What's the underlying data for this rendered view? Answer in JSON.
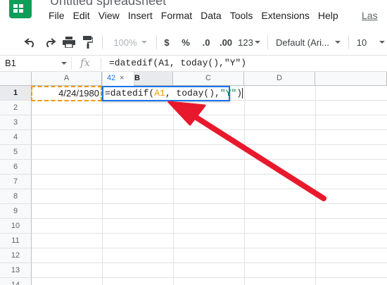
{
  "app": {
    "title": "Untitled spreadsheet",
    "logo": "sheets-logo-icon"
  },
  "menu": {
    "items": [
      "File",
      "Edit",
      "View",
      "Insert",
      "Format",
      "Data",
      "Tools",
      "Extensions",
      "Help"
    ],
    "extra": "Las"
  },
  "toolbar": {
    "undo": "undo-icon",
    "redo": "redo-icon",
    "print": "print-icon",
    "paint_format": "paint-format-icon",
    "zoom": "100%",
    "currency": "$",
    "percent": "%",
    "decrease_decimal": ".0",
    "increase_decimal": ".00",
    "more_formats": "123",
    "font": "Default (Ari...",
    "font_size": "10"
  },
  "formula_bar": {
    "name_box": "B1",
    "fx_icon": "fx-icon",
    "formula": "=datedif(A1, today(),\"Y\")"
  },
  "grid": {
    "columns": [
      "A",
      "B",
      "C",
      "D"
    ],
    "rows": [
      "1",
      "2",
      "3",
      "4",
      "5",
      "6",
      "7",
      "8",
      "9",
      "10",
      "11",
      "12",
      "13",
      "14"
    ],
    "cells": {
      "A1": "4/24/1980"
    },
    "editor": {
      "prefix": "=datedif(",
      "ref": "A1",
      "middle": ", today(),",
      "string": "\"Y\"",
      "suffix": ")"
    },
    "hint_tab": {
      "value": "42",
      "close": "×"
    }
  },
  "colors": {
    "accent": "#1a73e8",
    "reference": "#f29900",
    "string": "#0b8043",
    "annotation_arrow": "#e8192c",
    "logo": "#0f9d58"
  }
}
